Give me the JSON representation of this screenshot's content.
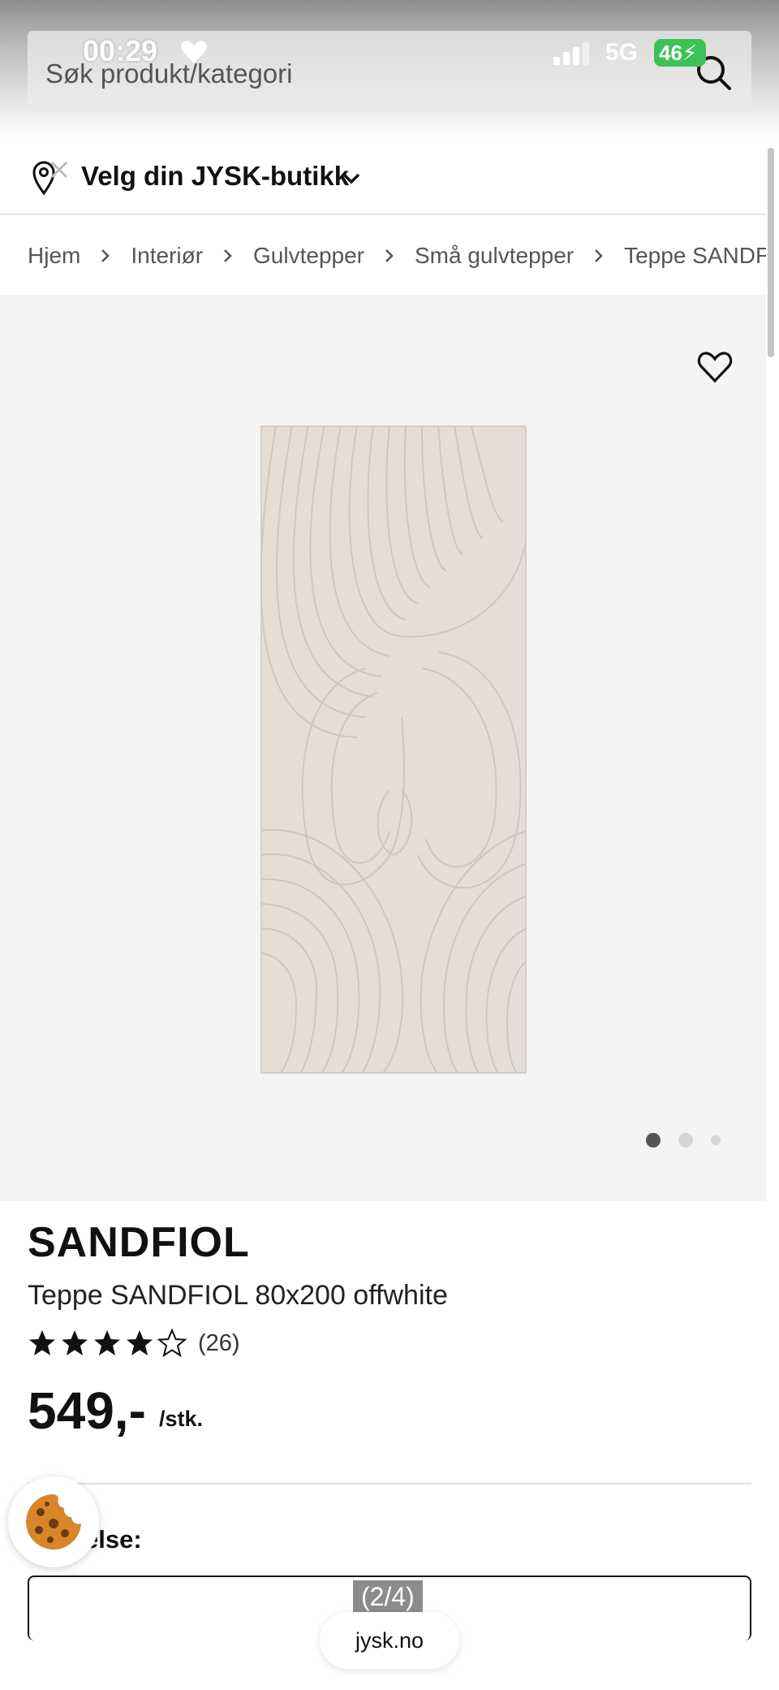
{
  "status_bar": {
    "time": "00:29",
    "network": "5G",
    "battery": "46"
  },
  "search": {
    "placeholder": "Søk produkt/kategori"
  },
  "store": {
    "label": "Velg din JYSK-butikk"
  },
  "breadcrumb": [
    "Hjem",
    "Interiør",
    "Gulvtepper",
    "Små gulvtepper",
    "Teppe SANDFIOL"
  ],
  "gallery": {
    "slides": 3,
    "active_slide": 1
  },
  "product": {
    "brand": "SANDFIOL",
    "name": "Teppe SANDFIOL 80x200 offwhite",
    "rating": 4,
    "rating_count": "(26)",
    "price": "549,-",
    "unit": "/stk.",
    "section_label": "else:"
  },
  "bottom": {
    "pager": "(2/4)",
    "url": "jysk.no"
  },
  "colors": {
    "accent_battery": "#3cc257",
    "text": "#111111",
    "gallery_bg": "#f4f4f4"
  },
  "icons": [
    "search-icon",
    "heart-icon",
    "location-pin-icon",
    "chevron-down-icon",
    "chevron-right-icon",
    "favorite-heart-icon",
    "star-icon",
    "cookie-icon"
  ]
}
